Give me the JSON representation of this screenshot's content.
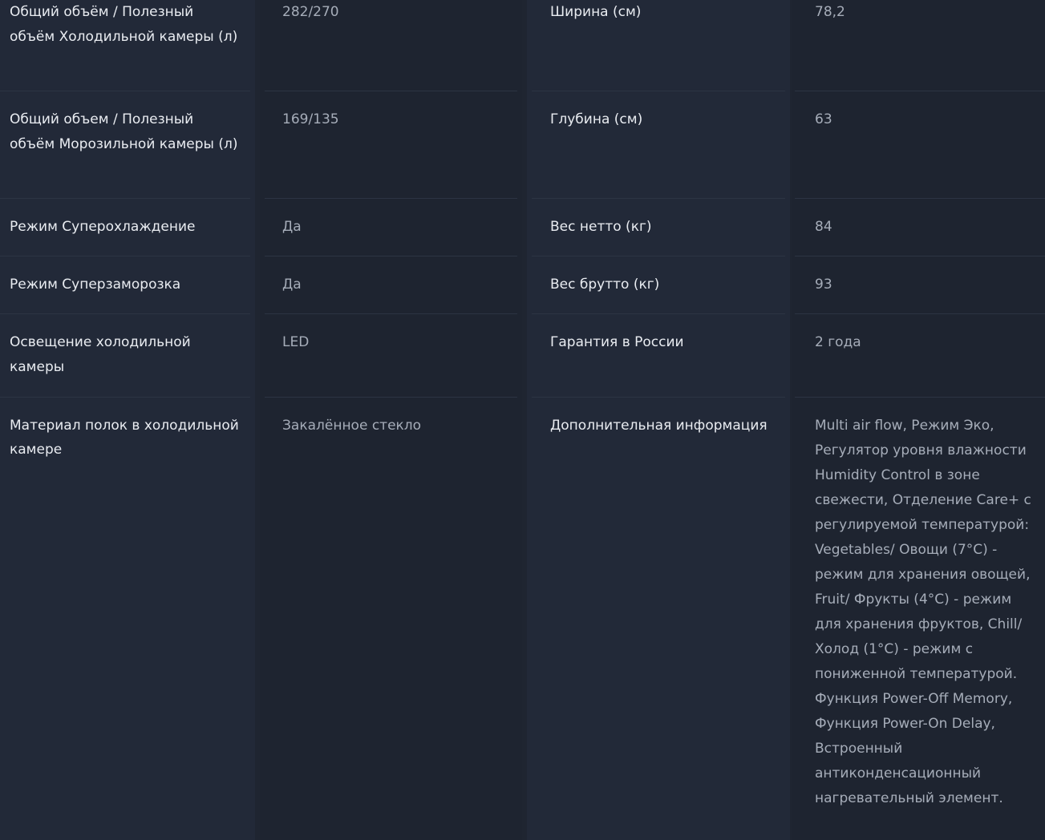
{
  "specs": {
    "rows": [
      {
        "label_left": "Общий объём / Полезный объём Холодильной камеры (л)",
        "value_left": "282/270",
        "label_right": "Ширина (см)",
        "value_right": "78,2"
      },
      {
        "label_left": "Общий объем / Полезный объём Морозильной камеры (л)",
        "value_left": "169/135",
        "label_right": "Глубина (см)",
        "value_right": "63"
      },
      {
        "label_left": "Режим Суперохлаждение",
        "value_left": "Да",
        "label_right": "Вес нетто (кг)",
        "value_right": "84"
      },
      {
        "label_left": "Режим Суперзаморозка",
        "value_left": "Да",
        "label_right": "Вес брутто (кг)",
        "value_right": "93"
      },
      {
        "label_left": "Освещение холодильной камеры",
        "value_left": "LED",
        "label_right": "Гарантия в России",
        "value_right": "2 года"
      },
      {
        "label_left": "Материал полок в холодильной камере",
        "value_left": "Закалённое стекло",
        "label_right": "Дополнительная информация",
        "value_right": "Multi air flow, Режим Эко, Регулятор уровня влажности Humidity Control в зоне свежести, Отделение Care+ с регулируемой температурой: Vegetables/ Овощи (7°C) - режим для хранения овощей, Fruit/ Фрукты (4°C) - режим для хранения фруктов, Chill/ Холод (1°C) - режим с пониженной температурой. Функция Power-Off Memory, Функция Power-On Delay, Встроенный антиконденсационный нагревательный элемент."
      }
    ]
  }
}
